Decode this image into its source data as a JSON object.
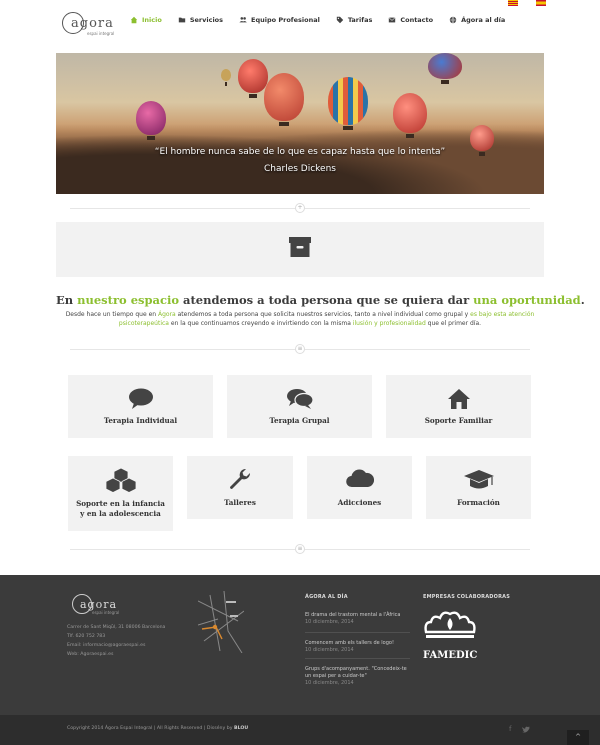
{
  "logo": {
    "word": "agora",
    "tagline": "espai integral"
  },
  "nav": {
    "items": [
      {
        "label": "Inicio",
        "icon": "home-icon",
        "active": true
      },
      {
        "label": "Servicios",
        "icon": "folder-icon"
      },
      {
        "label": "Equipo Profesional",
        "icon": "users-icon"
      },
      {
        "label": "Tarifas",
        "icon": "tag-icon"
      },
      {
        "label": "Contacto",
        "icon": "envelope-icon"
      },
      {
        "label": "Ágora al día",
        "icon": "globe-icon"
      }
    ]
  },
  "languages": [
    {
      "code": "ca",
      "icon": "catalan-flag-icon"
    },
    {
      "code": "es",
      "icon": "spanish-flag-icon"
    }
  ],
  "hero": {
    "quote": "“El hombre nunca sabe de lo que es capaz hasta que lo intenta”",
    "author": "Charles Dickens"
  },
  "headline": {
    "p1": "En ",
    "h1": "nuestro espacio",
    "p2": " atendemos a toda persona que se quiera dar ",
    "h2": "una oportunidad",
    "p3": "."
  },
  "intro": {
    "t1": "Desde hace un tiempo que en ",
    "g1": "Ágora",
    "t2": " atendemos a toda persona que solicita nuestros servicios,  tanto a nivel individual como grupal y ",
    "g2": "es bajo esta atención psicoterapeútica",
    "t3": " en la que continuamos creyendo e invirtiendo con la misma ",
    "g3": "ilusión y profesionalidad",
    "t4": " que el primer día."
  },
  "services": [
    {
      "label": "Terapia Individual",
      "icon": "speech-bubble-icon"
    },
    {
      "label": "Terapia Grupal",
      "icon": "chat-bubbles-icon"
    },
    {
      "label": "Soporte Familiar",
      "icon": "house-icon"
    },
    {
      "label": "Soporte en la infancia y en la adolescencia",
      "icon": "blocks-icon"
    },
    {
      "label": "Talleres",
      "icon": "wrench-icon"
    },
    {
      "label": "Adicciones",
      "icon": "cloud-icon"
    },
    {
      "label": "Formación",
      "icon": "graduation-cap-icon"
    }
  ],
  "footer": {
    "logo_word": "agora",
    "logo_tag": "espai integral",
    "address": "Carrer de Sant Miqǘl, 31 08006 Barcelona",
    "tel": "Tlf. 620 752 783",
    "email": "Email: informacio@agoraespai.es",
    "web": "Web: Agoraespai.es",
    "news_heading": "ÁGORA AL DÍA",
    "news": [
      {
        "title": "El drama del trastorn mental a l'Àfrica",
        "date": "10 diciembre, 2014"
      },
      {
        "title": "Comencem amb els tallers de logo!",
        "date": "10 diciembre, 2014"
      },
      {
        "title": "Grups d'acompanyament. \"Concedeix-te un espai per a cuidar-te\"",
        "date": "10 diciembre, 2014"
      }
    ],
    "partners_heading": "EMPRESAS COLABORADORAS",
    "partner_name": "FAMEDIC",
    "copyright_pre": "Copyright 2014 Ágora Espai Integral | All Rights Reserved | Dissény by ",
    "copyright_brand": "BLOU",
    "social": [
      "facebook-icon",
      "twitter-icon"
    ]
  },
  "colors": {
    "accent": "#8cbf2f",
    "footer": "#3b3b3b",
    "footer_bar": "#2d2d2d",
    "card": "#f2f2f2"
  }
}
